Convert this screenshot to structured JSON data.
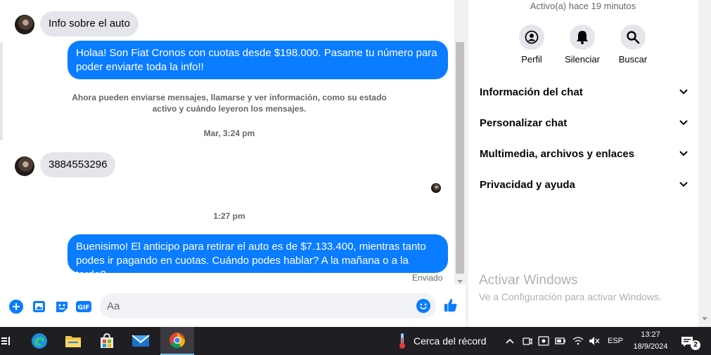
{
  "chat": {
    "messages": {
      "msg1": "Info sobre el auto",
      "msg2_line1": "Holaa! Son Fiat Cronos con cuotas desde $198.000. Pasame tu número para",
      "msg2_line2": "poder enviarte toda la info!!",
      "system_line1": "Ahora pueden enviarse mensajes, llamarse y ver información, como su estado",
      "system_line2": "activo y cuándo leyeron los mensajes.",
      "time1": "Mar, 3:24 pm",
      "msg3": "3884553296",
      "time2": "1:27 pm",
      "msg4_line1": "Buenisimo! El anticipo para retirar el auto es de $7.133.400, mientras tanto",
      "msg4_line2": "podes ir pagando en cuotas. Cuándo podes hablar? A la mañana o a la tarde?",
      "status": "Enviado"
    },
    "composer": {
      "placeholder": "Aa",
      "icons": [
        "plus-icon",
        "image-icon",
        "sticker-icon",
        "gif-icon",
        "emoji-icon",
        "thumbs-up-icon"
      ]
    }
  },
  "panel": {
    "active_text": "Activo(a) hace 19 minutos",
    "actions": {
      "profile": "Perfil",
      "mute": "Silenciar",
      "search": "Buscar"
    },
    "sections": {
      "chat_info": "Información del chat",
      "customize": "Personalizar chat",
      "media": "Multimedia, archivos y enlaces",
      "privacy": "Privacidad y ayuda"
    },
    "watermark": {
      "title": "Activar Windows",
      "subtitle": "Ve a Configuración para activar Windows."
    }
  },
  "taskbar": {
    "weather_text": "Cerca del récord",
    "language": "ESP",
    "time": "13:27",
    "date": "18/9/2024",
    "notification_count": "2",
    "apps": [
      "taskview-icon",
      "edge-icon",
      "file-explorer-icon",
      "store-icon",
      "mail-icon",
      "chrome-icon"
    ]
  },
  "colors": {
    "accent": "#0a7cff",
    "incoming_bubble": "#e4e6eb",
    "taskbar": "#1f1f23"
  }
}
